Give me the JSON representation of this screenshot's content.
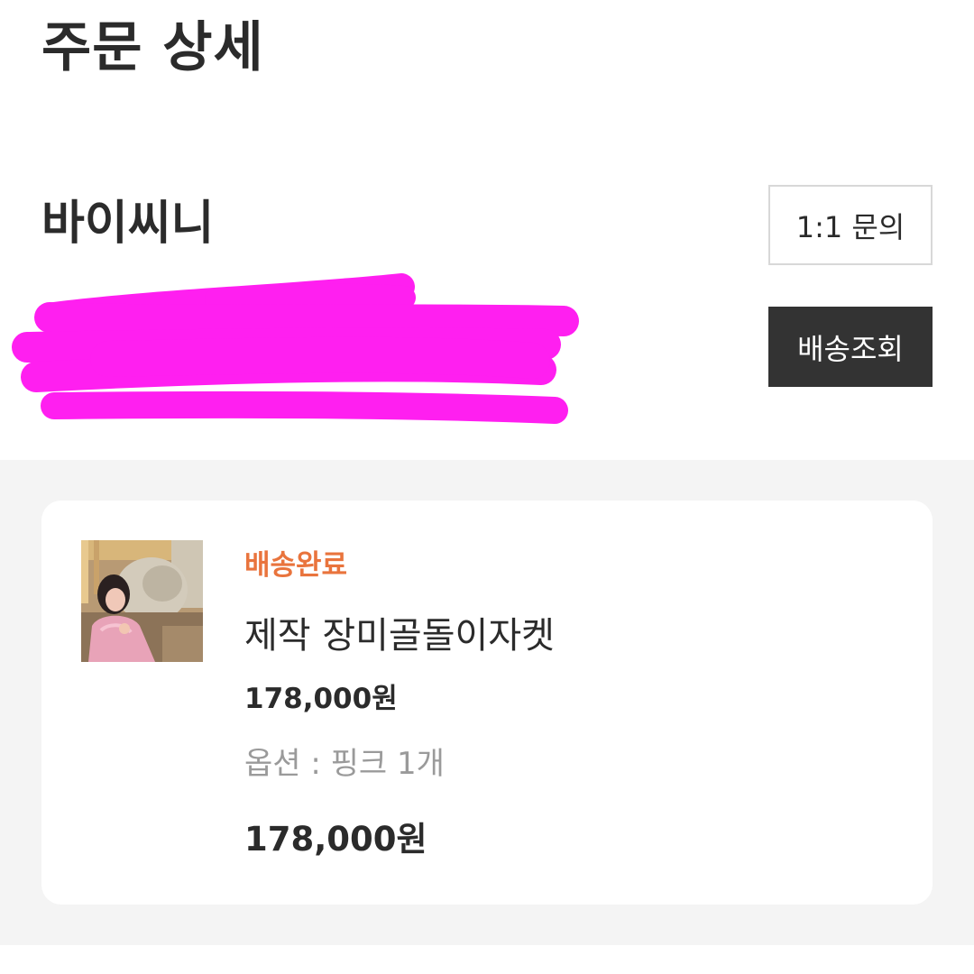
{
  "page": {
    "title": "주문 상세"
  },
  "shop": {
    "name": "바이씨니"
  },
  "buttons": {
    "inquiry_label": "1:1 문의",
    "tracking_label": "배송조회"
  },
  "order_item": {
    "status": "배송완료",
    "product_name": "제작 장미골돌이자켓",
    "unit_price": "178,000원",
    "option_label": "옵션",
    "option_value": "핑크 1개",
    "total_price": "178,000원"
  },
  "colors": {
    "status_orange": "#e9743d",
    "tracking_button_bg": "#333333",
    "redaction_magenta": "#ff1ff0",
    "section_gray": "#f4f4f4"
  }
}
